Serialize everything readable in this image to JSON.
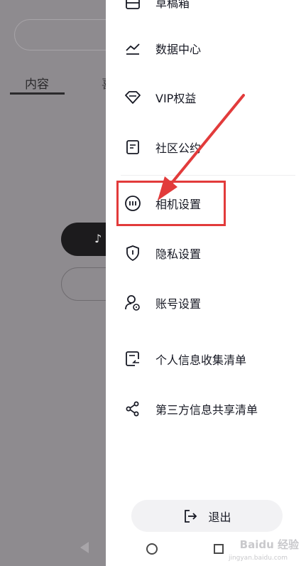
{
  "background": {
    "tabs": [
      {
        "label": "内容"
      },
      {
        "label": "喜"
      }
    ],
    "tiktok_glyph": "♪"
  },
  "drawer": {
    "top_partial_label": "草稿箱",
    "items": [
      {
        "label": "数据中心",
        "icon": "chart-line-icon"
      },
      {
        "label": "VIP权益",
        "icon": "diamond-icon"
      },
      {
        "label": "社区公约",
        "icon": "document-icon"
      },
      {
        "label": "相机设置",
        "icon": "camera-settings-icon"
      },
      {
        "label": "隐私设置",
        "icon": "shield-icon"
      },
      {
        "label": "账号设置",
        "icon": "user-settings-icon"
      },
      {
        "label": "个人信息收集清单",
        "icon": "info-list-icon"
      },
      {
        "label": "第三方信息共享清单",
        "icon": "share-icon"
      }
    ],
    "logout_label": "退出"
  },
  "annotation": {
    "highlight_color": "#e23b3b"
  },
  "watermark": {
    "text": "Baidu 经验",
    "sub": "jingyan.baidu.com"
  }
}
